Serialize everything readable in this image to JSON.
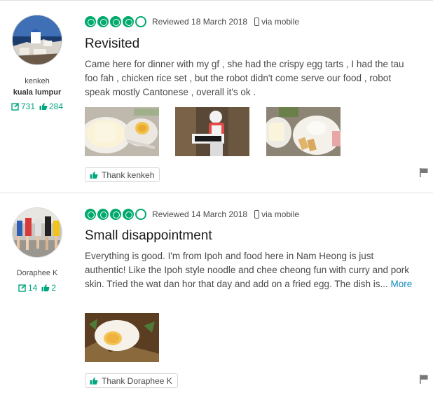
{
  "colors": {
    "accent": "#00aa6c",
    "link": "#118cbd",
    "text": "#4a4a4a"
  },
  "reviews": [
    {
      "user": {
        "name": "kenkeh",
        "location": "kuala lumpur",
        "contributions": "731",
        "helpful_votes": "284"
      },
      "rating": 4,
      "rated_date": "Reviewed 18 March 2018",
      "via": "via mobile",
      "title": "Revisited",
      "text": "Came here for dinner with my gf , she had the crispy egg tarts , I had the tau foo fah , chicken rice set , but the robot didn't come serve our food , robot speak mostly Cantonese , overall it's ok .",
      "more": "",
      "photos": [
        "tau-foo-fah-and-egg-tart",
        "serving-robot",
        "chicken-rice-set"
      ],
      "thank_label": "Thank kenkeh"
    },
    {
      "user": {
        "name": "Doraphee K",
        "location": "",
        "contributions": "14",
        "helpful_votes": "2"
      },
      "rating": 4,
      "rated_date": "Reviewed 14 March 2018",
      "via": "via mobile",
      "title": "Small disappointment",
      "text": "Everything is good. I'm from Ipoh and food here in Nam Heong is just authentic! Like the Ipoh style noodle and chee cheong fun with curry and pork skin. Tried the wat dan hor that day and add on a fried egg. The dish is...",
      "more": "More",
      "photos": [
        "fried-egg-on-noodles"
      ],
      "thank_label": "Thank Doraphee K"
    }
  ]
}
